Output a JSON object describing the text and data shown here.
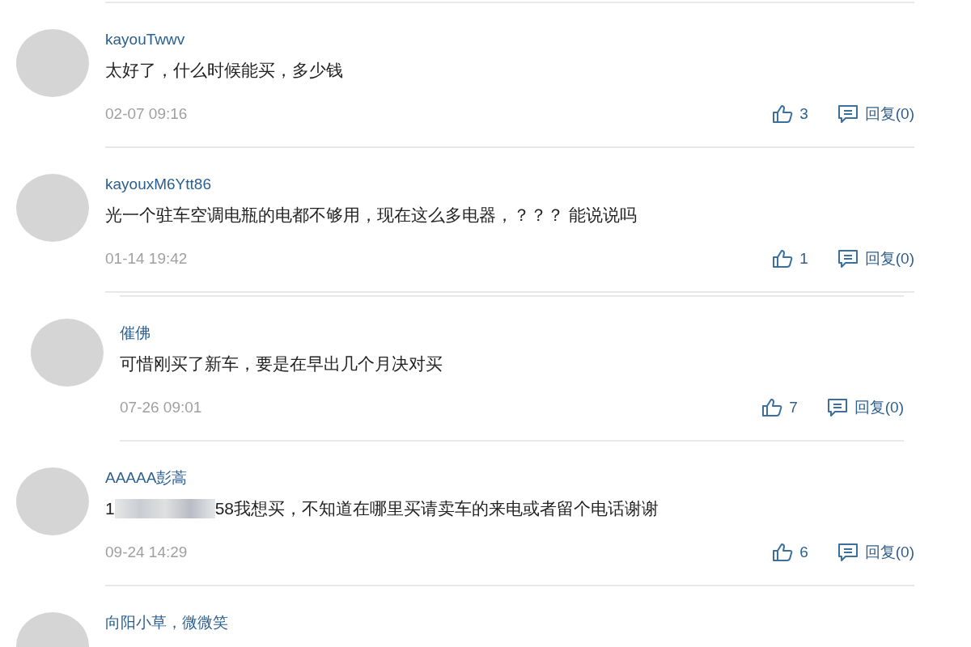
{
  "comments": [
    {
      "kind": "comment",
      "name": "kayouTwwv",
      "body": [
        {
          "kind": "text",
          "text": "太好了，什么时候能买，多少钱"
        }
      ],
      "date": "02-07 09:16",
      "likes": "3",
      "reply_label": "回复(0)"
    },
    {
      "kind": "comment",
      "name": "kayouxM6Ytt86",
      "body": [
        {
          "kind": "text",
          "text": "光一个驻车空调电瓶的电都不够用，现在这么多电器，？？？ 能说说吗"
        }
      ],
      "date": "01-14 19:42",
      "likes": "1",
      "reply_label": "回复(0)"
    },
    {
      "kind": "reply",
      "name": "催佛",
      "body": [
        {
          "kind": "text",
          "text": "可惜刚买了新车，要是在早出几个月决对买"
        }
      ],
      "date": "07-26 09:01",
      "likes": "7",
      "reply_label": "回复(0)"
    },
    {
      "kind": "comment",
      "name": "AAAAA彭蒿",
      "body": [
        {
          "kind": "text",
          "text": "1"
        },
        {
          "kind": "redacted"
        },
        {
          "kind": "text",
          "text": "58我想买，不知道在哪里买请卖车的来电或者留个电话谢谢"
        }
      ],
      "date": "09-24 14:29",
      "likes": "6",
      "reply_label": "回复(0)"
    },
    {
      "kind": "comment",
      "name": "向阳小草，微微笑"
    }
  ]
}
